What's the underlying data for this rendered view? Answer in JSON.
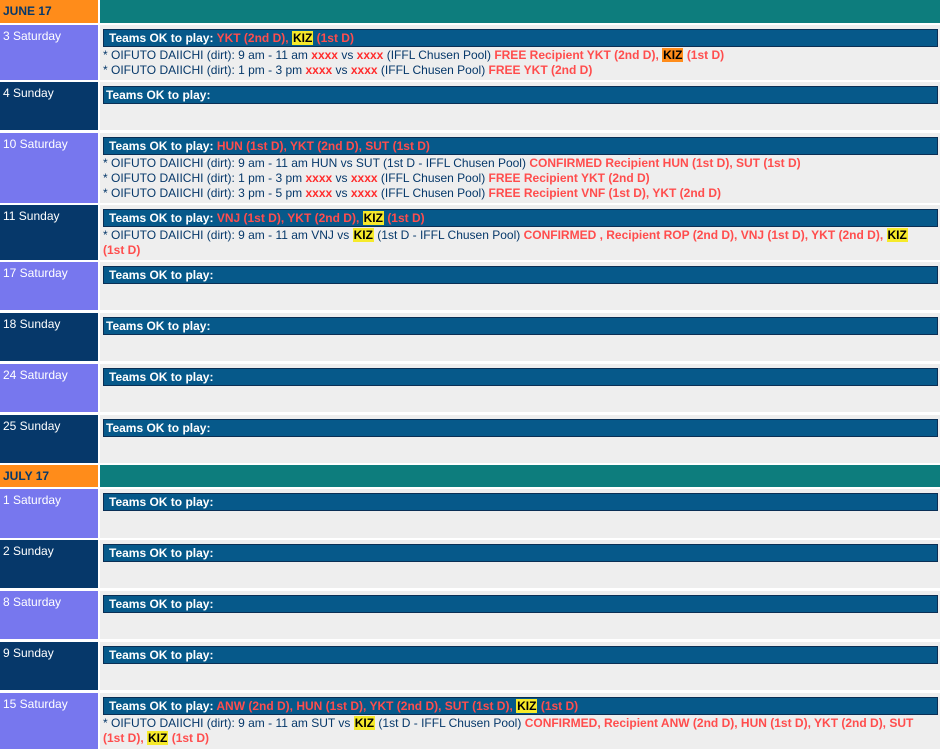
{
  "ok_label": "Teams OK to play:",
  "vs": "vs",
  "june": {
    "header": "JUNE 17",
    "d3": {
      "date": "3 Saturday",
      "teams_a": "YKT (2nd D),",
      "teams_kiz": "KIZ",
      "teams_b": "(1st D)",
      "g1_prefix": "* OIFUTO DAIICHI (dirt): 9 am - 11 am",
      "g1_t1": "xxxx",
      "g1_t2": "xxxx",
      "g1_pool": "(IFFL Chusen Pool)",
      "g1_status": "FREE Recipient YKT (2nd D),",
      "g1_kiz": "KIZ",
      "g1_tail": "(1st D)",
      "g2_prefix": "* OIFUTO DAIICHI (dirt): 1 pm - 3 pm",
      "g2_t1": "xxxx",
      "g2_t2": "xxxx",
      "g2_pool": "(IFFL Chusen Pool)",
      "g2_status": "FREE YKT (2nd D)"
    },
    "d4": {
      "date": "4 Sunday"
    },
    "d10": {
      "date": "10 Saturday",
      "teams": "HUN (1st D), YKT (2nd D), SUT (1st D)",
      "g1_text": "* OIFUTO DAIICHI (dirt): 9 am - 11 am HUN vs SUT (1st D - IFFL Chusen Pool)",
      "g1_status": "CONFIRMED Recipient HUN (1st D), SUT (1st D)",
      "g2_prefix": "* OIFUTO DAIICHI (dirt): 1 pm - 3 pm",
      "g2_t1": "xxxx",
      "g2_t2": "xxxx",
      "g2_pool": "(IFFL Chusen Pool)",
      "g2_status": "FREE Recipient YKT (2nd D)",
      "g3_prefix": "* OIFUTO DAIICHI (dirt): 3 pm - 5 pm",
      "g3_t1": "xxxx",
      "g3_t2": "xxxx",
      "g3_pool": "(IFFL Chusen Pool)",
      "g3_status": "FREE Recipient VNF (1st D), YKT (2nd D)"
    },
    "d11": {
      "date": "11 Sunday",
      "teams_a": "VNJ (1st D), YKT (2nd D),",
      "teams_kiz": "KIZ",
      "teams_b": "(1st D)",
      "g1_prefix": "* OIFUTO DAIICHI (dirt): 9 am - 11 am VNJ vs",
      "g1_kiz": "KIZ",
      "g1_pool": "(1st D - IFFL Chusen Pool)",
      "g1_status": "CONFIRMED , Recipient ROP (2nd D), VNJ (1st D), YKT (2nd D),",
      "g1_kiz2": "KIZ",
      "g1_tail": "(1st D)"
    },
    "d17": {
      "date": "17 Saturday"
    },
    "d18": {
      "date": "18 Sunday"
    },
    "d24": {
      "date": "24 Saturday"
    },
    "d25": {
      "date": "25 Sunday"
    }
  },
  "july": {
    "header": "JULY 17",
    "d1": {
      "date": "1 Saturday"
    },
    "d2": {
      "date": "2 Sunday"
    },
    "d8": {
      "date": "8 Saturday"
    },
    "d9": {
      "date": "9 Sunday"
    },
    "d15": {
      "date": "15 Saturday",
      "teams_a": "ANW (2nd D), HUN (1st D), YKT (2nd D), SUT (1st D),",
      "teams_kiz": "KIZ",
      "teams_b": "(1st D)",
      "g1_prefix": "* OIFUTO DAIICHI (dirt): 9 am - 11 am SUT vs",
      "g1_kiz": "KIZ",
      "g1_pool": "(1st D - IFFL Chusen Pool)",
      "g1_status": "CONFIRMED, Recipient ANW (2nd D), HUN (1st D), YKT (2nd D), SUT (1st D),",
      "g1_kiz2": "KIZ",
      "g1_tail": "(1st D)"
    }
  }
}
